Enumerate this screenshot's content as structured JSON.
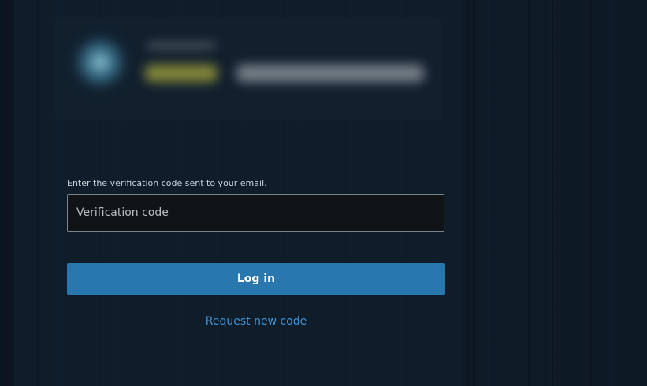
{
  "form": {
    "instruction": "Enter the verification code sent to your email.",
    "code_placeholder": "Verification code",
    "code_value": "",
    "login_label": "Log in",
    "request_label": "Request new code"
  },
  "colors": {
    "background": "#0f1c29",
    "input_background": "#101417",
    "button_primary": "#2877ae",
    "link": "#3f93d8"
  },
  "logo": {
    "icon": "blurred-brand-logo"
  }
}
